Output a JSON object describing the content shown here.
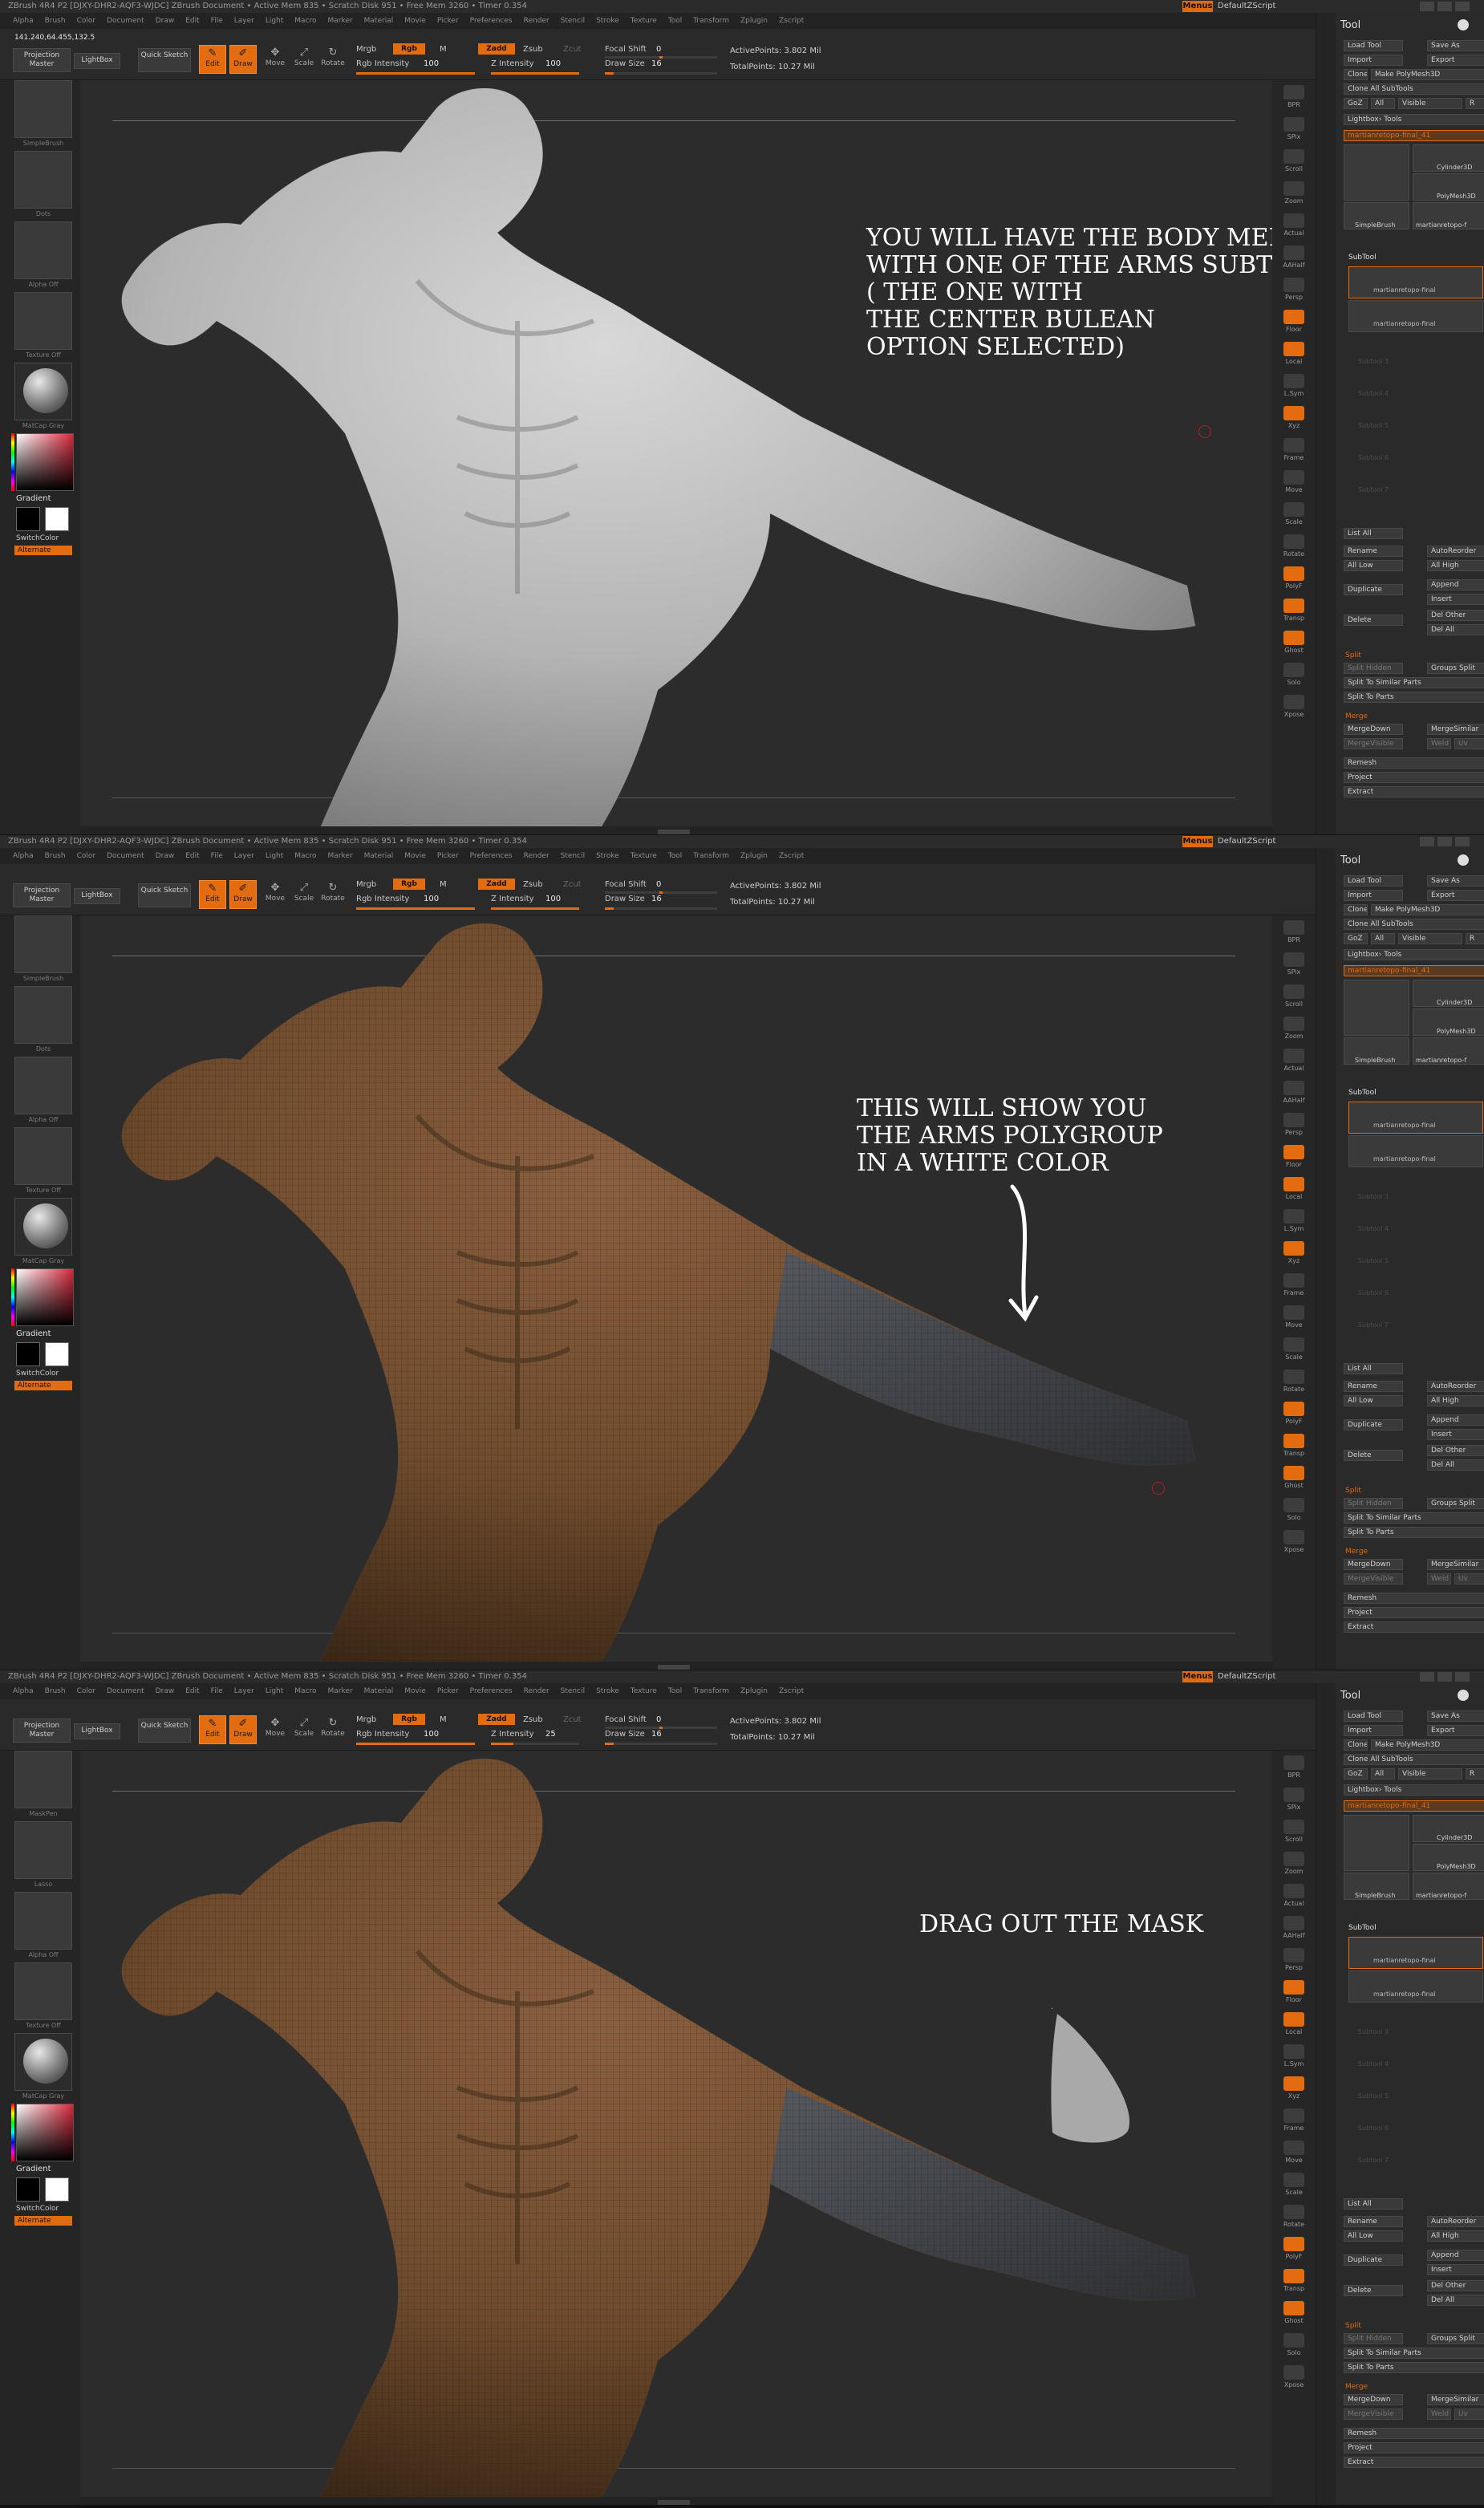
{
  "app": {
    "titlebar_text": "ZBrush 4R4 P2 [DJXY-DHR2-AQF3-WJDC]   ZBrush Document   • Active Mem 835 • Scratch Disk 951 • Free Mem 3260 • Timer 0.354",
    "menus_button": "Menus",
    "default_script": "DefaultZScript",
    "menu_items": [
      "Alpha",
      "Brush",
      "Color",
      "Document",
      "Draw",
      "Edit",
      "File",
      "Layer",
      "Light",
      "Macro",
      "Marker",
      "Material",
      "Movie",
      "Picker",
      "Preferences",
      "Render",
      "Stencil",
      "Stroke",
      "Texture",
      "Tool",
      "Transform",
      "Zplugin",
      "Zscript"
    ]
  },
  "shelf": {
    "projection_master": "Projection Master",
    "lightbox": "LightBox",
    "quick_sketch": "Quick Sketch",
    "edit": "Edit",
    "draw": "Draw",
    "move": "Move",
    "scale": "Scale",
    "rotate": "Rotate",
    "mrgb": "Mrgb",
    "rgb": "Rgb",
    "m": "M",
    "zadd": "Zadd",
    "zsub": "Zsub",
    "zcut": "Zcut",
    "focal_shift_label": "Focal Shift",
    "focal_shift_value": "0",
    "draw_size_label": "Draw Size",
    "draw_size_value": "16",
    "rgb_intensity_label": "Rgb Intensity",
    "rgb_intensity_value": "100",
    "z_intensity_label": "Z Intensity",
    "active_points": "ActivePoints: 3.802 Mil",
    "total_points": "TotalPoints: 10.27 Mil",
    "accent": "#e36b10"
  },
  "left": {
    "gradient": "Gradient",
    "switch_color": "SwitchColor",
    "alternate": "Alternate"
  },
  "tool_panel": {
    "title": "Tool",
    "load_tool": "Load Tool",
    "save_as": "Save As",
    "import": "Import",
    "export": "Export",
    "clone": "Clone",
    "make_polymesh": "Make PolyMesh3D",
    "clone_all": "Clone All SubTools",
    "goz": "GoZ",
    "all": "All",
    "visible": "Visible",
    "r": "R",
    "lightbox_tools": "Lightbox› Tools",
    "current_tool": "martianretopo-final_41",
    "thumb_cylinder": "Cylinder3D",
    "thumb_polymesh": "PolyMesh3D",
    "thumb_simplebrush": "SimpleBrush",
    "thumb_martian": "martianretopo-f",
    "subtool": "SubTool",
    "subtool_names": [
      "martianretopo-final",
      "martianretopo-final"
    ],
    "subtool_empty": [
      "Subtool 3",
      "Subtool 4",
      "Subtool 5",
      "Subtool 6",
      "Subtool 7"
    ],
    "list_all": "List All",
    "rename": "Rename",
    "auto_reorder": "AutoReorder",
    "all_low": "All Low",
    "all_high": "All High",
    "duplicate": "Duplicate",
    "append": "Append",
    "insert": "Insert",
    "delete": "Delete",
    "del_other": "Del Other",
    "del_all": "Del All",
    "split": "Split",
    "split_hidden": "Split Hidden",
    "groups_split": "Groups Split",
    "split_similar": "Split To Similar Parts",
    "split_parts": "Split To Parts",
    "merge": "Merge",
    "merge_down": "MergeDown",
    "merge_similar": "MergeSimilar",
    "merge_visible": "MergeVisible",
    "weld": "Weld",
    "uv": "Uv",
    "remesh": "Remesh",
    "project": "Project",
    "extract": "Extract"
  },
  "right_strip": [
    "BPR",
    "SPix",
    "Scroll",
    "Zoom",
    "Actual",
    "AAHalf",
    "Persp",
    "Floor",
    "Local",
    "L.Sym",
    "Xyz",
    "Frame",
    "Move",
    "Scale",
    "Rotate",
    "PolyF",
    "Transp",
    "Ghost",
    "Solo",
    "Xpose"
  ],
  "panels": [
    {
      "caption": [
        "YOU WILL HAVE THE BODY MERGED",
        "WITH ONE OF THE ARMS SUBTOOLS",
        "( THE ONE WITH",
        "THE CENTER BULEAN",
        "OPTION SELECTED)"
      ],
      "coord_readout": "141.240,64.455,132.5",
      "tiles": [
        "SimpleBrush",
        "Dots",
        "Alpha Off",
        "Texture Off",
        "MatCap Gray"
      ],
      "z_intensity": "100",
      "mesh_color": "#bfbfbf"
    },
    {
      "caption": [
        "THIS WILL SHOW YOU",
        "THE ARMS  POLYGROUP",
        "IN A WHITE COLOR"
      ],
      "tiles": [
        "SimpleBrush",
        "Dots",
        "Alpha Off",
        "Texture Off",
        "MatCap Gray"
      ],
      "z_intensity": "100",
      "mesh_color": "#7a5030"
    },
    {
      "caption": [
        "DRAG OUT THE MASK"
      ],
      "tiles": [
        "MaskPen",
        "Lasso",
        "Alpha Off",
        "Texture Off",
        "MatCap Gray"
      ],
      "z_intensity": "25",
      "mesh_color": "#7a5030"
    }
  ]
}
